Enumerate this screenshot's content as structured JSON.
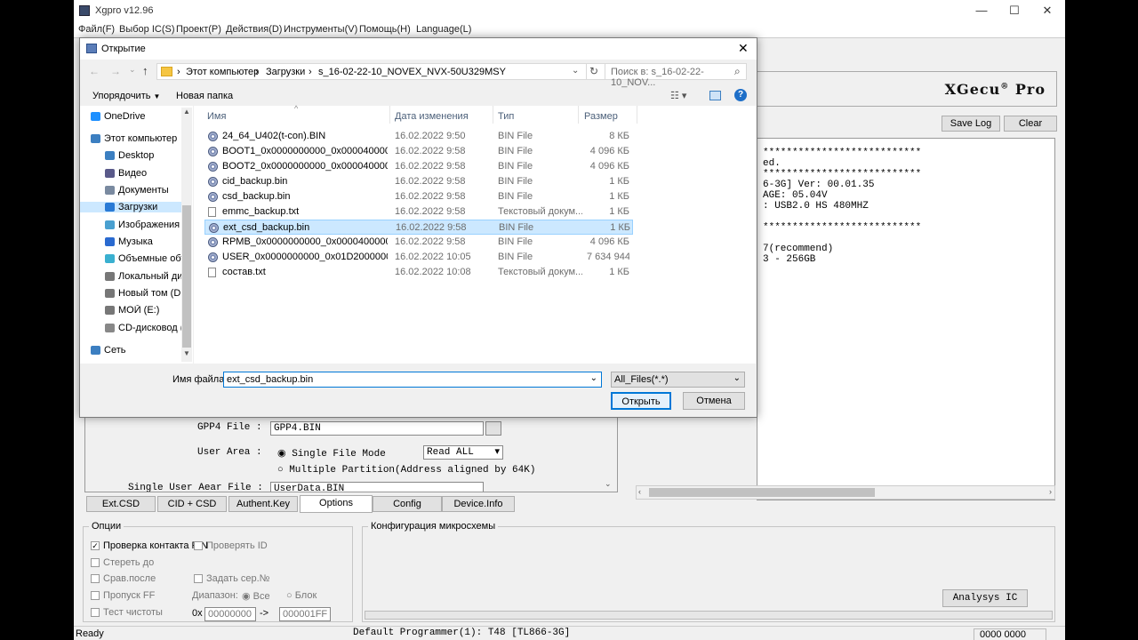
{
  "app": {
    "title": "Xgpro v12.96",
    "menu": [
      "Файл(F)",
      "Выбор IC(S)",
      "Проект(P)",
      "Действия(D)",
      "Инструменты(V)",
      "Помощь(H)",
      "Language(L)"
    ],
    "brand": "XGecu",
    "brand_suffix": "Pro",
    "save_log": "Save Log",
    "clear": "Clear",
    "log_lines": [
      "***************************",
      "ed.",
      "***************************",
      "6-3G] Ver: 00.01.35",
      "AGE: 05.04V",
      ": USB2.0 HS 480MHZ",
      "",
      "***************************",
      "",
      "7(recommend)",
      "3 - 256GB"
    ],
    "config": {
      "gpp4_label": "GPP4 File :",
      "gpp4_value": "GPP4.BIN",
      "user_area_label": "User Area :",
      "single_file_mode": "Single File Mode",
      "read_all": "Read ALL",
      "multiple_partition": "Multiple Partition(Address aligned by 64K)",
      "single_user_label": "Single User Aear File :",
      "single_user_value": "UserData.BIN"
    },
    "tabs": [
      "Ext.CSD",
      "CID + CSD",
      "Authent.Key",
      "Options",
      "Config",
      "Device.Info"
    ],
    "options_group": {
      "title": "Опции",
      "items": [
        "Проверка контакта PIN",
        "Стереть до",
        "Срав.после",
        "Пропуск FF",
        "Тест чистоты"
      ],
      "verify_id": "Проверять ID",
      "set_serial": "Задать сер.№",
      "range_label": "Диапазон:",
      "range_all": "Все",
      "range_block": "Блок",
      "hex_prefix": "0x",
      "from": "00000000",
      "arrow": "->",
      "to": "000001FF"
    },
    "chip_config_title": "Конфигурация микросхемы",
    "analysis_btn": "Analysys IC",
    "status": {
      "left": "Ready",
      "center": "Default Programmer(1): T48 [TL866-3G]",
      "right": "0000 0000"
    }
  },
  "dialog": {
    "title": "Открытие",
    "breadcrumb": [
      "Этот компьютер",
      "Загрузки",
      "s_16-02-22-10_NOVEX_NVX-50U329MSY"
    ],
    "search_placeholder": "Поиск в: s_16-02-22-10_NOV...",
    "organize": "Упорядочить",
    "new_folder": "Новая папка",
    "nav": [
      {
        "label": "OneDrive",
        "icon": "cloud-icon",
        "color": "#1e90ff"
      },
      {
        "label": "Этот компьютер",
        "icon": "computer-icon",
        "color": "#3c7fc1"
      },
      {
        "label": "Desktop",
        "icon": "desktop-icon",
        "color": "#3c7fc1"
      },
      {
        "label": "Видео",
        "icon": "video-icon",
        "color": "#5a5a8a"
      },
      {
        "label": "Документы",
        "icon": "documents-icon",
        "color": "#7a8aa0"
      },
      {
        "label": "Загрузки",
        "icon": "download-icon",
        "color": "#2a7ad5"
      },
      {
        "label": "Изображения",
        "icon": "images-icon",
        "color": "#4aa0d0"
      },
      {
        "label": "Музыка",
        "icon": "music-icon",
        "color": "#2a6ad0"
      },
      {
        "label": "Объемные объ",
        "icon": "3d-icon",
        "color": "#3ab0d0"
      },
      {
        "label": "Локальный дис",
        "icon": "drive-icon",
        "color": "#777"
      },
      {
        "label": "Новый том (D:)",
        "icon": "drive-icon",
        "color": "#777"
      },
      {
        "label": "МОЙ (E:)",
        "icon": "drive-icon",
        "color": "#777"
      },
      {
        "label": "CD-дисковод (G",
        "icon": "cd-icon",
        "color": "#888"
      },
      {
        "label": "Сеть",
        "icon": "network-icon",
        "color": "#3c7fc1"
      }
    ],
    "columns": [
      "Имя",
      "Дата изменения",
      "Тип",
      "Размер"
    ],
    "files": [
      {
        "name": "24_64_U402(t-con).BIN",
        "date": "16.02.2022 9:50",
        "type": "BIN File",
        "size": "8 КБ",
        "kind": "bin"
      },
      {
        "name": "BOOT1_0x0000000000_0x0000400000_bac...",
        "date": "16.02.2022 9:58",
        "type": "BIN File",
        "size": "4 096 КБ",
        "kind": "bin"
      },
      {
        "name": "BOOT2_0x0000000000_0x0000400000_bac...",
        "date": "16.02.2022 9:58",
        "type": "BIN File",
        "size": "4 096 КБ",
        "kind": "bin"
      },
      {
        "name": "cid_backup.bin",
        "date": "16.02.2022 9:58",
        "type": "BIN File",
        "size": "1 КБ",
        "kind": "bin"
      },
      {
        "name": "csd_backup.bin",
        "date": "16.02.2022 9:58",
        "type": "BIN File",
        "size": "1 КБ",
        "kind": "bin"
      },
      {
        "name": "emmc_backup.txt",
        "date": "16.02.2022 9:58",
        "type": "Текстовый докум...",
        "size": "1 КБ",
        "kind": "txt"
      },
      {
        "name": "ext_csd_backup.bin",
        "date": "16.02.2022 9:58",
        "type": "BIN File",
        "size": "1 КБ",
        "kind": "bin",
        "selected": true
      },
      {
        "name": "RPMB_0x0000000000_0x0000400000_back...",
        "date": "16.02.2022 9:58",
        "type": "BIN File",
        "size": "4 096 КБ",
        "kind": "bin"
      },
      {
        "name": "USER_0x0000000000_0x01D2000000_back...",
        "date": "16.02.2022 10:05",
        "type": "BIN File",
        "size": "7 634 944 КБ",
        "kind": "bin"
      },
      {
        "name": "состав.txt",
        "date": "16.02.2022 10:08",
        "type": "Текстовый докум...",
        "size": "1 КБ",
        "kind": "txt"
      }
    ],
    "filename_label": "Имя файла:",
    "filename_value": "ext_csd_backup.bin",
    "filter_value": "All_Files(*.*)",
    "open_btn": "Открыть",
    "cancel_btn": "Отмена"
  }
}
